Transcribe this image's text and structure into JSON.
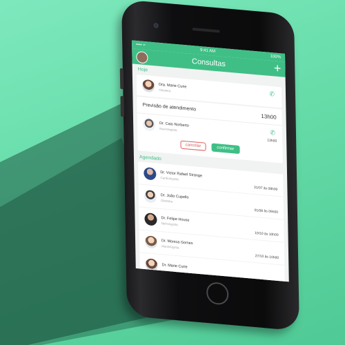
{
  "status": {
    "left": "•••• ≈",
    "time": "9:41 AM",
    "battery": "100%"
  },
  "nav": {
    "title": "Consultas",
    "add_icon": "plus-icon"
  },
  "today": {
    "header": "Hoje",
    "first": {
      "name": "Dra. Marie Curie",
      "specialty": "Obstetra"
    },
    "preview_label": "Previsão de atendimento",
    "preview_time": "13h00",
    "second": {
      "name": "Dr. Caio Norberto",
      "specialty": "Neurologista",
      "time": "13h00"
    },
    "cancel_label": "cancelar",
    "confirm_label": "confirmar"
  },
  "scheduled": {
    "header": "Agendado",
    "items": [
      {
        "name": "Dr. Victor Rafael Strange",
        "specialty": "Cardiologista",
        "date": "31/07 às 08h00"
      },
      {
        "name": "Dr. João Cupello",
        "specialty": "Obstetra",
        "date": "01/08 às 09h00"
      },
      {
        "name": "Dr. Felipe House",
        "specialty": "Nefrologista",
        "date": "10/10 às 10h00"
      },
      {
        "name": "Dr. Monica Gomes",
        "specialty": "Mastologista",
        "date": "27/10 às 10h00"
      },
      {
        "name": "Dr. Marie Curie",
        "specialty": "",
        "date": ""
      }
    ]
  },
  "colors": {
    "accent": "#3fbf86",
    "background": "#6ddfae",
    "cancel": "#e05a5a"
  }
}
